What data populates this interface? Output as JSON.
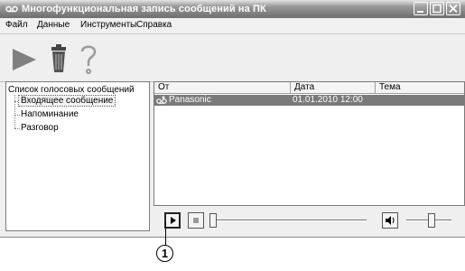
{
  "window": {
    "title": "Многофункциональная запись сообщений на ПК",
    "app_icon": "voicemail-icon",
    "controls": [
      "minimize-icon",
      "maximize-icon",
      "close-icon"
    ]
  },
  "menu": {
    "items": [
      {
        "label": "Файл"
      },
      {
        "label": "Данные"
      },
      {
        "label": "Инструменты"
      },
      {
        "label": "Справка"
      }
    ]
  },
  "toolbar": {
    "buttons": [
      "play-icon",
      "trash-icon",
      "help-icon"
    ]
  },
  "tree": {
    "root": "Список голосовых сообщений",
    "children": [
      "Входящее сообщение",
      "Напоминание",
      "Разговор"
    ],
    "selected_index": 0
  },
  "list": {
    "columns": [
      "От",
      "Дата",
      "Тема"
    ],
    "rows": [
      {
        "from": "Panasonic",
        "date": "01.01.2010 12:00",
        "subject": "",
        "icon": "voicemail-icon"
      }
    ]
  },
  "player": {
    "buttons": [
      "play-icon",
      "stop-icon",
      "volume-icon"
    ]
  },
  "callout": {
    "label": "1"
  },
  "colors": {
    "titlebar": "#6e6e6e",
    "selected_row": "#7a7a7a",
    "window_bg": "#efefef"
  }
}
